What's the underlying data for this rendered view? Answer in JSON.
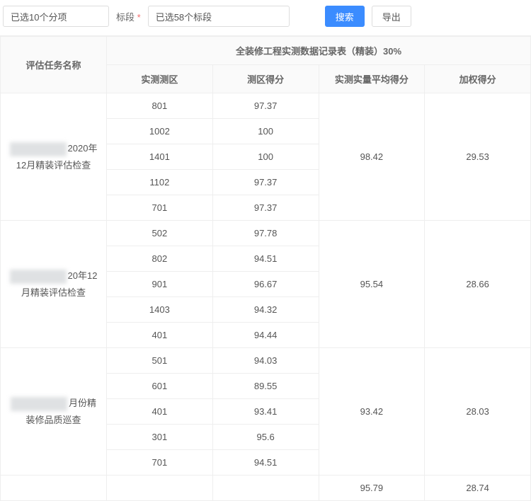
{
  "filters": {
    "category_value": "已选10个分项",
    "section_label": "标段",
    "section_value": "已选58个标段",
    "search_btn": "搜索",
    "export_btn": "导出"
  },
  "table": {
    "header_task": "评估任务名称",
    "header_group": "全装修工程实测数据记录表（精装）30%",
    "header_zone": "实测测区",
    "header_score": "测区得分",
    "header_avg": "实测实量平均得分",
    "header_weight": "加权得分",
    "rows": [
      {
        "task_suffix": "2020年12月精装评估检查",
        "zones": [
          "801",
          "1002",
          "1401",
          "1102",
          "701"
        ],
        "scores": [
          "97.37",
          "100",
          "100",
          "97.37",
          "97.37"
        ],
        "avg": "98.42",
        "weight": "29.53"
      },
      {
        "task_suffix": "20年12月精装评估检查",
        "zones": [
          "502",
          "802",
          "901",
          "1403",
          "401"
        ],
        "scores": [
          "97.78",
          "94.51",
          "96.67",
          "94.32",
          "94.44"
        ],
        "avg": "95.54",
        "weight": "28.66"
      },
      {
        "task_suffix": "月份精装修品质巡查",
        "zones": [
          "501",
          "601",
          "401",
          "301",
          "701"
        ],
        "scores": [
          "94.03",
          "89.55",
          "93.41",
          "95.6",
          "94.51"
        ],
        "avg": "93.42",
        "weight": "28.03"
      }
    ],
    "footer_avg": "95.79",
    "footer_weight": "28.74"
  }
}
